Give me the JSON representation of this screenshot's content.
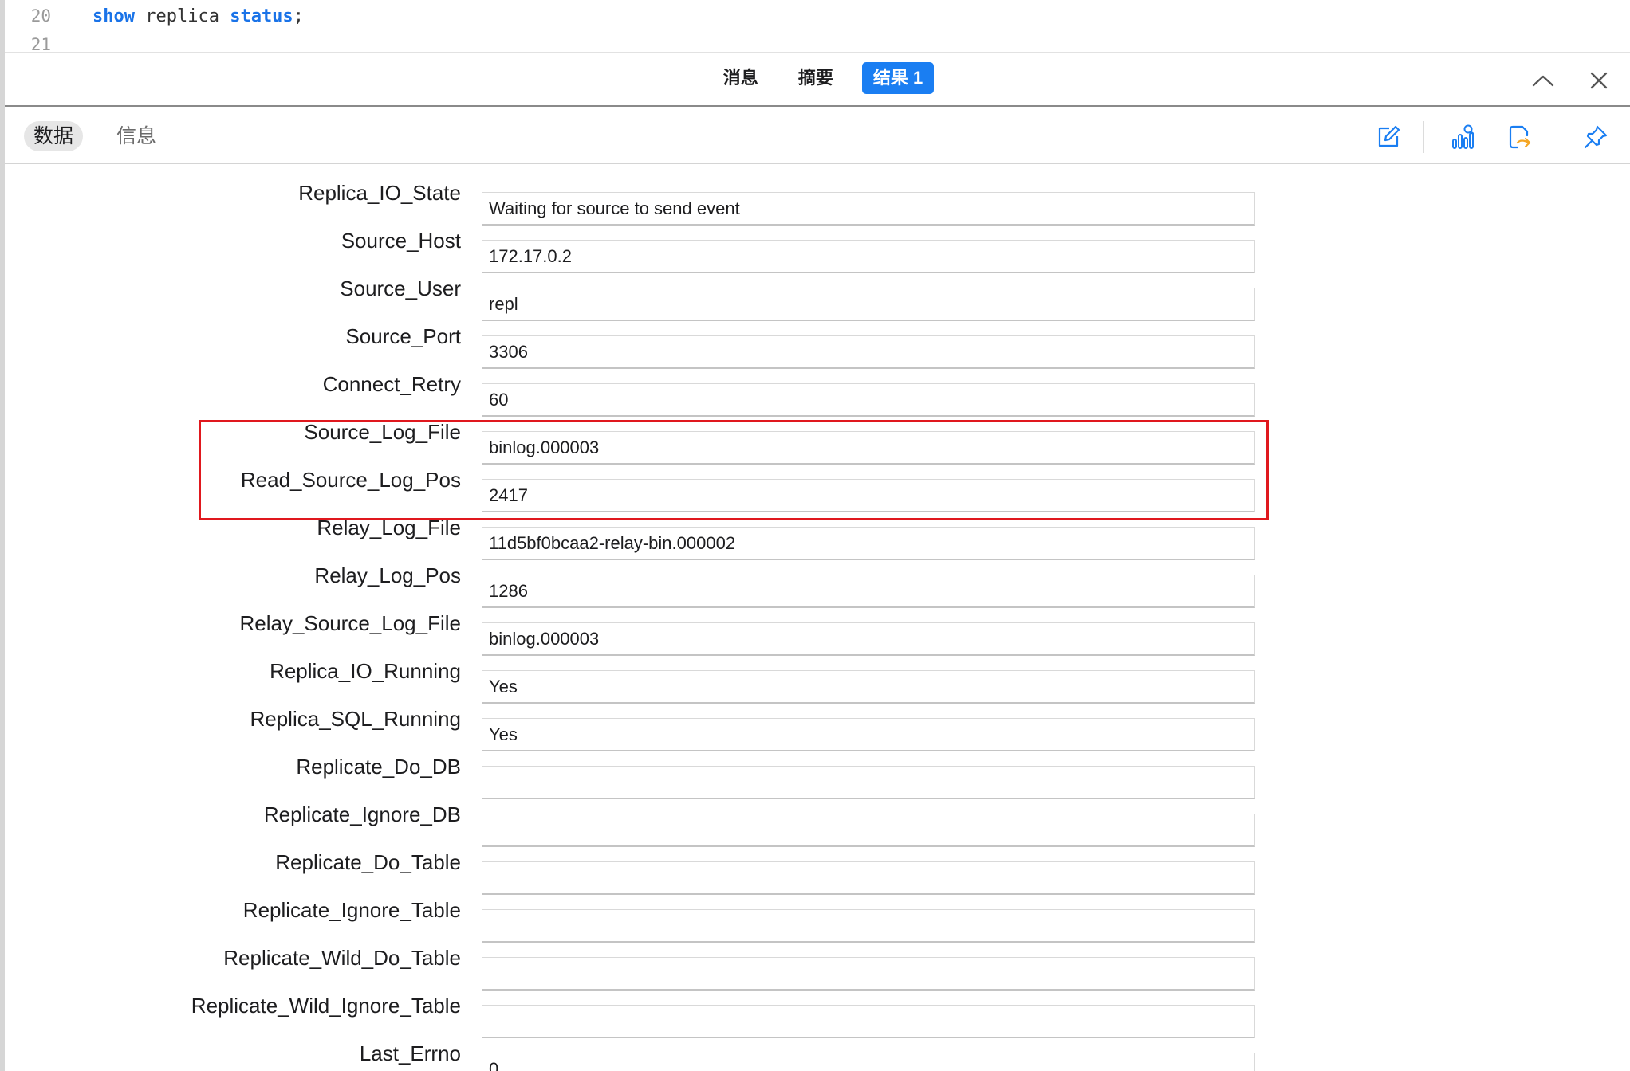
{
  "editor": {
    "lines": [
      {
        "number": "20",
        "tokens": [
          {
            "text": "show",
            "kind": "keyword"
          },
          {
            "text": " replica ",
            "kind": "plain"
          },
          {
            "text": "status",
            "kind": "keyword"
          },
          {
            "text": ";",
            "kind": "plain"
          }
        ]
      },
      {
        "number": "21",
        "tokens": []
      }
    ]
  },
  "result_tabs": [
    {
      "label": "消息",
      "active": false
    },
    {
      "label": "摘要",
      "active": false
    },
    {
      "label": "结果 1",
      "active": true
    }
  ],
  "window_controls": {
    "collapse_icon": "chevron-up-icon",
    "close_icon": "close-icon"
  },
  "view_tabs": [
    {
      "label": "数据",
      "active": true
    },
    {
      "label": "信息",
      "active": false
    }
  ],
  "toolbar_icons": [
    "edit-icon",
    "chart-search-icon",
    "export-icon",
    "pin-icon"
  ],
  "colors": {
    "accent": "#1a7ef2",
    "highlight_border": "#e0181e",
    "export_accent": "#f5a623"
  },
  "fields": [
    {
      "name": "Replica_IO_State",
      "value": "Waiting for source to send event"
    },
    {
      "name": "Source_Host",
      "value": "172.17.0.2"
    },
    {
      "name": "Source_User",
      "value": "repl"
    },
    {
      "name": "Source_Port",
      "value": "3306"
    },
    {
      "name": "Connect_Retry",
      "value": "60"
    },
    {
      "name": "Source_Log_File",
      "value": "binlog.000003"
    },
    {
      "name": "Read_Source_Log_Pos",
      "value": "2417"
    },
    {
      "name": "Relay_Log_File",
      "value": "11d5bf0bcaa2-relay-bin.000002"
    },
    {
      "name": "Relay_Log_Pos",
      "value": "1286"
    },
    {
      "name": "Relay_Source_Log_File",
      "value": "binlog.000003"
    },
    {
      "name": "Replica_IO_Running",
      "value": "Yes"
    },
    {
      "name": "Replica_SQL_Running",
      "value": "Yes"
    },
    {
      "name": "Replicate_Do_DB",
      "value": ""
    },
    {
      "name": "Replicate_Ignore_DB",
      "value": ""
    },
    {
      "name": "Replicate_Do_Table",
      "value": ""
    },
    {
      "name": "Replicate_Ignore_Table",
      "value": ""
    },
    {
      "name": "Replicate_Wild_Do_Table",
      "value": ""
    },
    {
      "name": "Replicate_Wild_Ignore_Table",
      "value": ""
    },
    {
      "name": "Last_Errno",
      "value": "0"
    }
  ],
  "highlighted_fields": [
    "Source_Log_File",
    "Read_Source_Log_Pos"
  ]
}
